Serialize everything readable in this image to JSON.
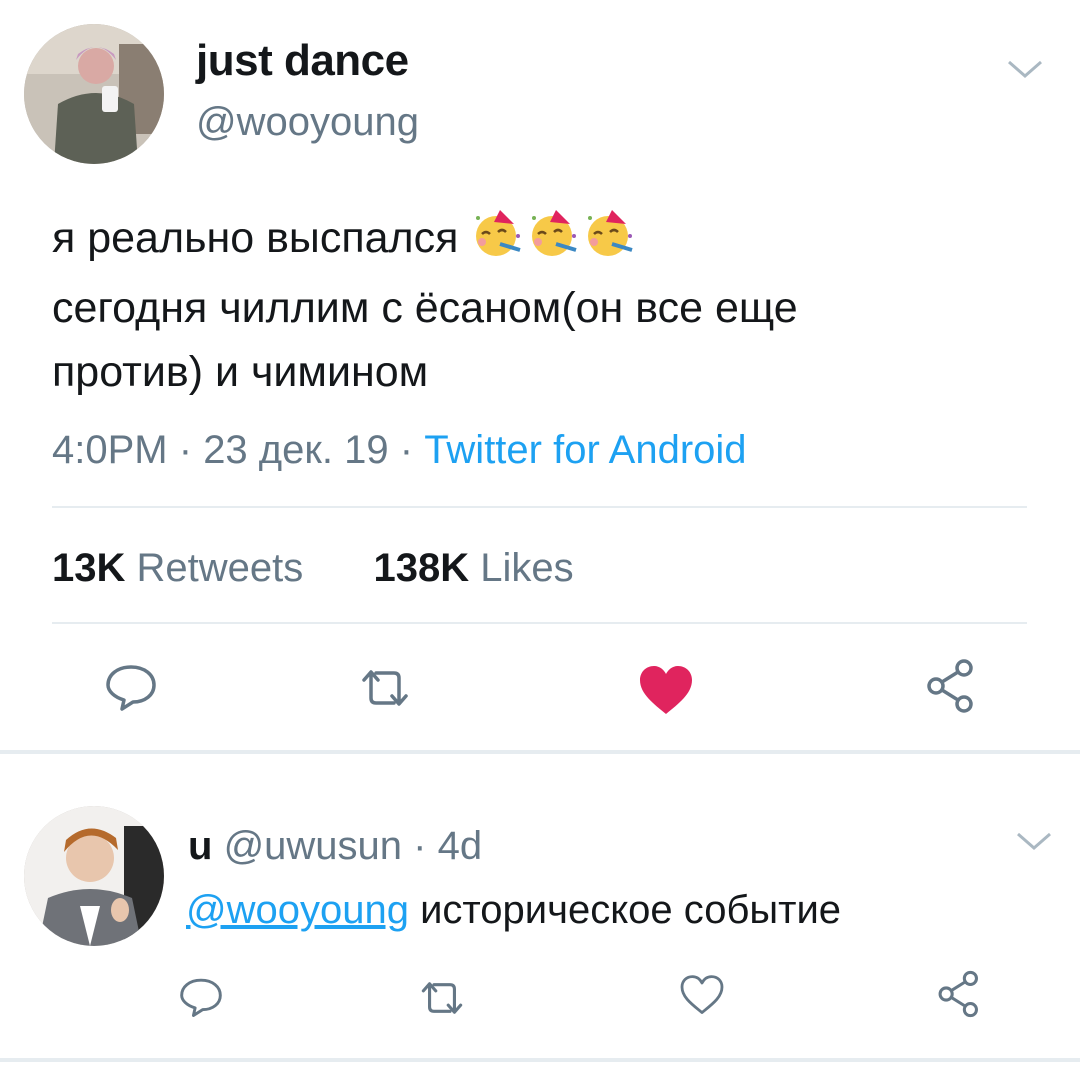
{
  "tweet": {
    "display_name": "just dance",
    "handle": "@wooyoung",
    "text_line1": "я реально выспался",
    "text_rest": "сегодня чиллим с ёсаном(он все еще\nпротив) и чимином",
    "emoji": [
      "partying-face",
      "partying-face",
      "partying-face"
    ],
    "time": "4:0PM",
    "dot1": "·",
    "date": "23 дек. 19",
    "dot2": "·",
    "source": "Twitter for Android",
    "retweets_count": "13K",
    "retweets_label": "Retweets",
    "likes_count": "138K",
    "likes_label": "Likes",
    "liked": true
  },
  "reply": {
    "display_name": "u",
    "handle": "@uwusun",
    "dot": "·",
    "age": "4d",
    "mention": "@wooyoung",
    "text": " историческое событие"
  },
  "colors": {
    "link": "#1da1f2",
    "muted": "#657786",
    "like": "#e0245e",
    "divider": "#e6ecf0"
  }
}
